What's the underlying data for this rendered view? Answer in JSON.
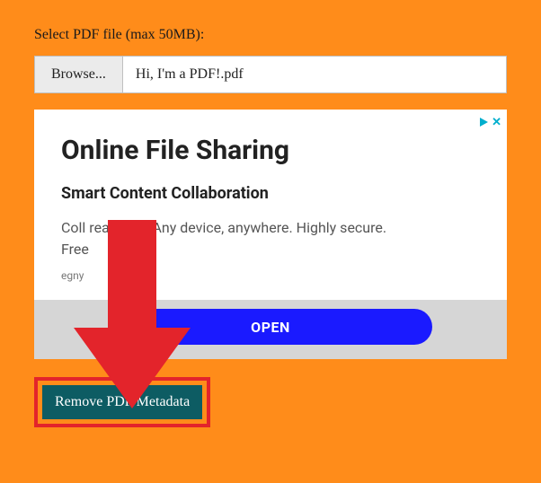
{
  "form": {
    "label": "Select PDF file (max 50MB):",
    "browse_label": "Browse...",
    "filename": "Hi, I'm a PDF!.pdf"
  },
  "ad": {
    "title": "Online File Sharing",
    "subtitle": "Smart Content Collaboration",
    "body_line1": "Coll               real time. Any device, anywhere. Highly secure.",
    "body_line2": "Free",
    "source": "egny",
    "cta": "OPEN"
  },
  "action": {
    "label": "Remove PDF Metadata"
  }
}
